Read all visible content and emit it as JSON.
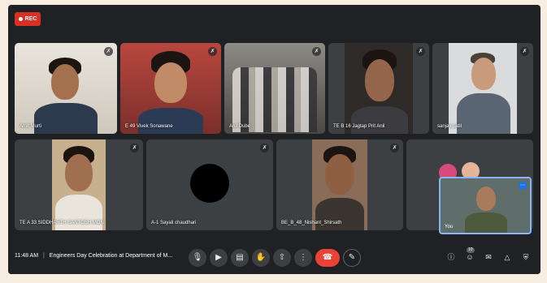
{
  "recording": {
    "label": "REC"
  },
  "tiles": [
    {
      "name": "Amit Murti"
    },
    {
      "name": "E 49 Vivek Sonawane"
    },
    {
      "name": "Anil Dube"
    },
    {
      "name": "TE B 16 Jagtap Prit Anil"
    },
    {
      "name": "sanjay patil"
    },
    {
      "name": "TE A 33 SIDDHARTH SANTOSH MON"
    },
    {
      "name": "A-1 Sayali chaudhari"
    },
    {
      "name": "BE_B_48_Nishant_Shirsath"
    },
    {
      "name": ""
    }
  ],
  "self_view": {
    "name": "You"
  },
  "meeting": {
    "time": "11:48 AM",
    "separator": "|",
    "title": "Engineers Day Celebration at Department of M..."
  },
  "controls": {
    "mic_icon": "mic-icon",
    "camera_icon": "camera-icon",
    "captions_icon": "captions-icon",
    "hand_icon": "raise-hand-icon",
    "present_icon": "present-icon",
    "more_icon": "more-vert-icon",
    "end_icon": "call-end-icon",
    "pen_icon": "pen-icon"
  },
  "right_controls": {
    "people_count": "10"
  },
  "colors": {
    "end_call": "#ea4335",
    "rec": "#d93025",
    "selfview_border": "#8ab4f8"
  }
}
